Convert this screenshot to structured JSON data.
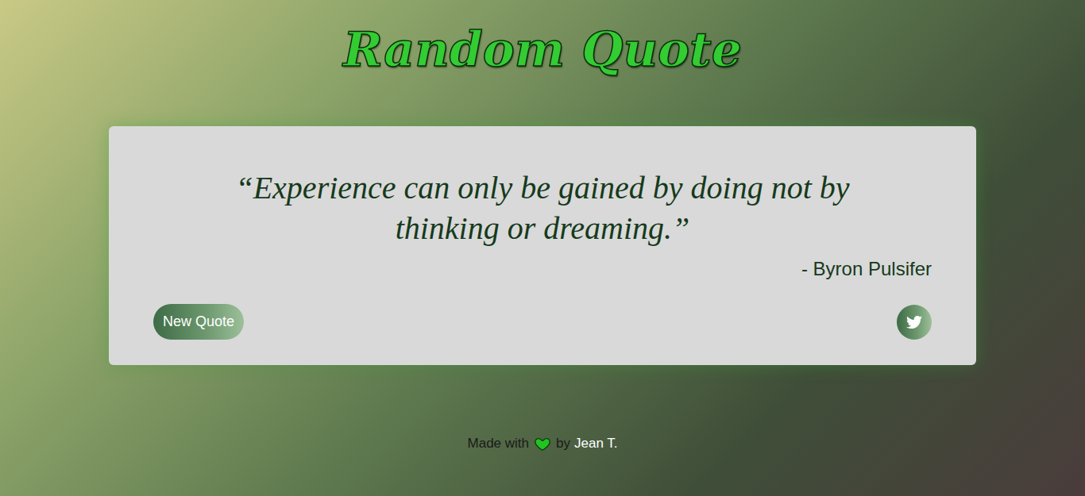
{
  "page": {
    "title": "Random Quote"
  },
  "quote": {
    "text": "“Experience can only be gained by doing not by thinking or dreaming.”",
    "author": "- Byron Pulsifer"
  },
  "buttons": {
    "new_quote": "New Quote"
  },
  "footer": {
    "prefix": "Made with",
    "suffix": "by",
    "author": "Jean T."
  }
}
